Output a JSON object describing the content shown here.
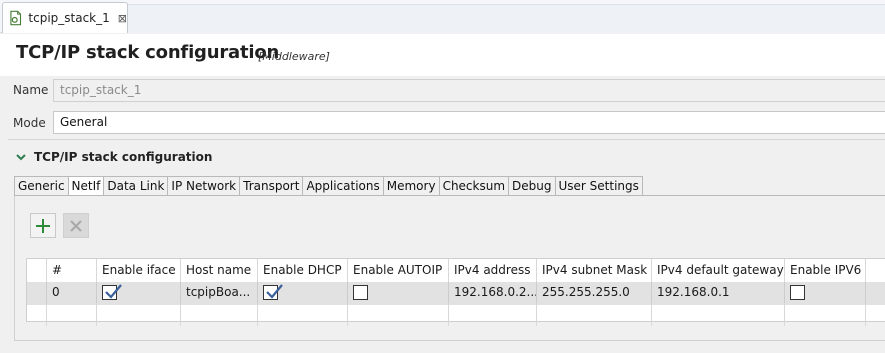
{
  "editor_tab": {
    "label": "tcpip_stack_1",
    "close_glyph": "⊠"
  },
  "header": {
    "title": "TCP/IP stack configuration",
    "subtitle": "[Middleware]"
  },
  "name_field": {
    "label": "Name",
    "value": "tcpip_stack_1"
  },
  "mode_field": {
    "label": "Mode",
    "value": "General"
  },
  "section": {
    "title": "TCP/IP stack configuration"
  },
  "subtabs": [
    "Generic",
    "NetIf",
    "Data Link",
    "IP Network",
    "Transport",
    "Applications",
    "Memory",
    "Checksum",
    "Debug",
    "User Settings"
  ],
  "active_subtab": "NetIf",
  "toolbar": {
    "add_icon": "plus-icon",
    "remove_icon": "x-icon",
    "add_color": "#2e8b3a"
  },
  "table": {
    "columns": [
      "",
      "#",
      "Enable iface",
      "Host name",
      "Enable DHCP",
      "Enable AUTOIP",
      "IPv4 address",
      "IPv4 subnet Mask",
      "IPv4 default gateway",
      "Enable IPV6"
    ],
    "rows": [
      {
        "index": "0",
        "enable_iface": true,
        "host_name": "tcpipBoa...",
        "enable_dhcp": true,
        "enable_autoip": false,
        "ipv4_address": "192.168.0.2...",
        "ipv4_subnet_mask": "255.255.255.0",
        "ipv4_default_gateway": "192.168.0.1",
        "enable_ipv6": false
      }
    ]
  },
  "colors": {
    "accent": "#2e8b3a",
    "selected_row": "#e2e2e2",
    "check": "#3a5f9a"
  }
}
